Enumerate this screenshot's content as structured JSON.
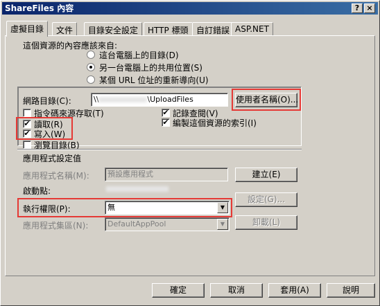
{
  "window": {
    "title": "ShareFiles 內容",
    "help_glyph": "?",
    "close_glyph": "×"
  },
  "tabs": [
    "虛擬目錄",
    "文件",
    "目錄安全設定",
    "HTTP 標頭",
    "自訂錯誤",
    "ASP.NET"
  ],
  "content_source": {
    "label": "這個資源的內容應該來自:",
    "options": [
      "這台電腦上的目錄(D)",
      "另一台電腦上的共用位置(S)",
      "某個 URL 位址的重新導向(U)"
    ],
    "selected_index": 1
  },
  "network": {
    "label": "網路目錄(C):",
    "value_prefix": "\\\\",
    "value_suffix": "\\UploadFiles",
    "connect_as_button": "使用者名稱(O)..."
  },
  "permissions": {
    "script_source": {
      "label": "指令碼來源存取(T)",
      "checked": ""
    },
    "read": {
      "label": "讀取(R)",
      "checked": "✔"
    },
    "write": {
      "label": "寫入(W)",
      "checked": "✔"
    },
    "browse": {
      "label": "瀏覽目錄(B)",
      "checked": ""
    },
    "log_visits": {
      "label": "記錄查閱(V)",
      "checked": "✔"
    },
    "index": {
      "label": "編製這個資源的索引(I)",
      "checked": "✔"
    }
  },
  "app_settings": {
    "title": "應用程式設定值",
    "app_name_label": "應用程式名稱(M):",
    "app_name_value": "預設應用程式",
    "create_button": "建立(E)",
    "start_point_label": "啟動點:",
    "exec_perm_label": "執行權限(P):",
    "exec_perm_value": "無",
    "config_button": "設定(G)...",
    "app_pool_label": "應用程式集區(N):",
    "app_pool_value": "DefaultAppPool",
    "unload_button": "卸載(L)"
  },
  "footer": {
    "ok": "確定",
    "cancel": "取消",
    "apply": "套用(A)",
    "help": "說明"
  },
  "colors": {
    "highlight": "#e53935",
    "titlebar_start": "#0a246a",
    "titlebar_end": "#3a6ea5",
    "face": "#d4d0c8"
  }
}
